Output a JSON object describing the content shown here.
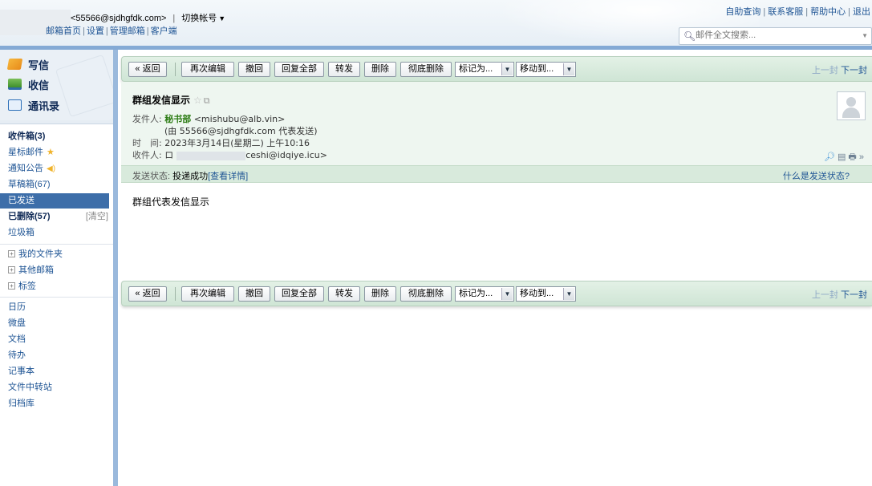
{
  "header": {
    "account_email": "<55566@sjdhgfdk.com>",
    "separator": "|",
    "switch_account": "切换帐号",
    "mail_links": [
      "邮箱首页",
      "设置",
      "管理邮箱",
      "客户端"
    ],
    "top_links": [
      "自助查询",
      "联系客服",
      "帮助中心",
      "退出"
    ],
    "search_placeholder": "邮件全文搜索..."
  },
  "sidebar": {
    "quick": {
      "write": "写信",
      "receive": "收信",
      "contacts": "通讯录"
    },
    "folders": [
      {
        "label": "收件箱(3)"
      },
      {
        "label": "星标邮件"
      },
      {
        "label": "通知公告"
      },
      {
        "label": "草稿箱(67)"
      },
      {
        "label": "已发送"
      },
      {
        "label": "已删除(57)",
        "extra": "[清空]"
      },
      {
        "label": "垃圾箱"
      }
    ],
    "groups": [
      "我的文件夹",
      "其他邮箱",
      "标签"
    ],
    "apps": [
      "日历",
      "微盘",
      "文档",
      "待办",
      "记事本",
      "文件中转站",
      "归档库"
    ]
  },
  "toolbar": {
    "back": "« 返回",
    "edit_again": "再次编辑",
    "undo": "撤回",
    "reply_all": "回复全部",
    "forward": "转发",
    "delete": "删除",
    "delete_forever": "彻底删除",
    "mark_as": "标记为...",
    "move_to": "移动到...",
    "prev": "上一封",
    "next": "下一封"
  },
  "mail": {
    "subject": "群组发信显示",
    "from_label": "发件人:",
    "sender_name": "秘书部",
    "sender_email": "<mishubu@alb.vin>",
    "on_behalf": "(由 55566@sjdhgfdk.com 代表发送)",
    "time_label": "时　间:",
    "time": "2023年3月14日(星期二) 上午10:16",
    "to_label": "收件人:",
    "to_prefix": "ロ",
    "to_email": "ceshi@idqiye.icu>",
    "status_label": "发送状态:",
    "status_value": "投递成功",
    "status_detail": "[查看详情]",
    "status_help": "什么是发送状态?",
    "body": "群组代表发信显示"
  },
  "colors": {
    "accent": "#3d6ea9",
    "toolbar_green": "#cfe5d5",
    "sender_green": "#2e7d16",
    "link_blue": "#1e5494"
  }
}
